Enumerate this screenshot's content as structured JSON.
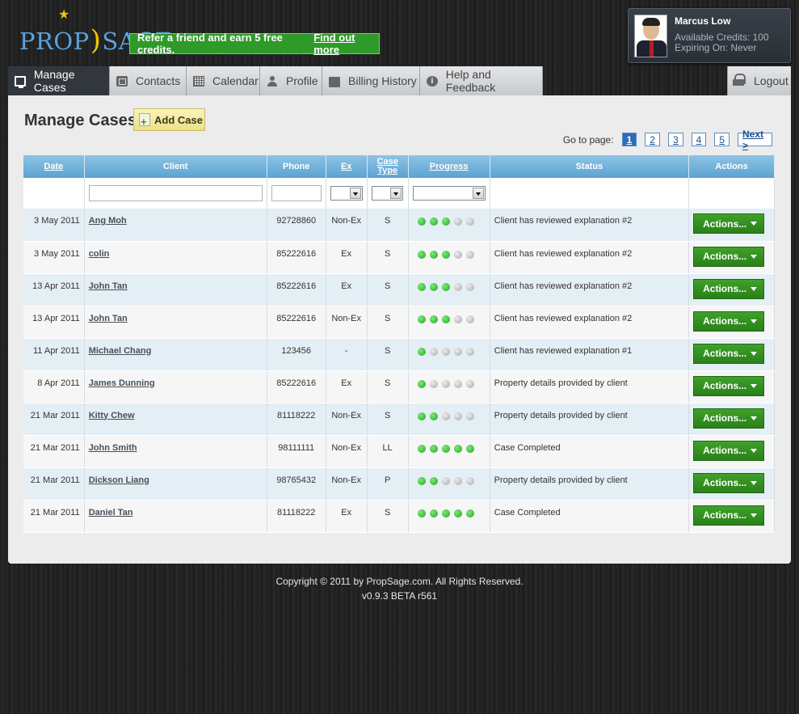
{
  "brand": {
    "name_left": "PROP",
    "name_right": "SAGE"
  },
  "promo": {
    "text": "Refer a friend and earn 5 free credits.",
    "link": "Find out more"
  },
  "user": {
    "name": "Marcus Low",
    "credits": "Available Credits: 100",
    "expiry": "Expiring On: Never"
  },
  "nav": {
    "tabs": [
      {
        "label": "Manage Cases",
        "icon": "monitor-icon"
      },
      {
        "label": "Contacts",
        "icon": "contacts-book-icon"
      },
      {
        "label": "Calendar",
        "icon": "calendar-icon"
      },
      {
        "label": "Profile",
        "icon": "user-icon"
      },
      {
        "label": "Billing History",
        "icon": "cash-icon"
      },
      {
        "label": "Help and Feedback",
        "icon": "help-icon"
      }
    ],
    "logout": "Logout"
  },
  "page": {
    "title": "Manage Cases",
    "add_case": "Add Case"
  },
  "pager": {
    "label": "Go to page:",
    "pages": [
      "1",
      "2",
      "3",
      "4",
      "5"
    ],
    "current": "1",
    "next": "Next >"
  },
  "table": {
    "headers": {
      "date": "Date",
      "client": "Client",
      "phone": "Phone",
      "ex": "Ex",
      "case_type_1": "Case",
      "case_type_2": "Type",
      "progress": "Progress",
      "status": "Status",
      "actions": "Actions"
    },
    "action_label": "Actions...",
    "rows": [
      {
        "date": "3 May 2011",
        "client": "Ang Moh",
        "phone": "92728860",
        "ex": "Non-Ex",
        "type": "S",
        "progress": 3,
        "status": "Client has reviewed explanation #2"
      },
      {
        "date": "3 May 2011",
        "client": "colin",
        "phone": "85222616",
        "ex": "Ex",
        "type": "S",
        "progress": 3,
        "status": "Client has reviewed explanation #2"
      },
      {
        "date": "13 Apr 2011",
        "client": "John Tan",
        "phone": "85222616",
        "ex": "Ex",
        "type": "S",
        "progress": 3,
        "status": "Client has reviewed explanation #2"
      },
      {
        "date": "13 Apr 2011",
        "client": "John Tan",
        "phone": "85222616",
        "ex": "Non-Ex",
        "type": "S",
        "progress": 3,
        "status": "Client has reviewed explanation #2"
      },
      {
        "date": "11 Apr 2011",
        "client": "Michael Chang",
        "phone": "123456",
        "ex": "-",
        "type": "S",
        "progress": 1,
        "status": "Client has reviewed explanation #1"
      },
      {
        "date": "8 Apr 2011",
        "client": "James Dunning",
        "phone": "85222616",
        "ex": "Ex",
        "type": "S",
        "progress": 1,
        "status": "Property details provided by client"
      },
      {
        "date": "21 Mar 2011",
        "client": "Kitty Chew",
        "phone": "81118222",
        "ex": "Non-Ex",
        "type": "S",
        "progress": 2,
        "status": "Property details provided by client"
      },
      {
        "date": "21 Mar 2011",
        "client": "John Smith",
        "phone": "98111111",
        "ex": "Non-Ex",
        "type": "LL",
        "progress": 5,
        "status": "Case Completed"
      },
      {
        "date": "21 Mar 2011",
        "client": "Dickson Liang",
        "phone": "98765432",
        "ex": "Non-Ex",
        "type": "P",
        "progress": 2,
        "status": "Property details provided by client"
      },
      {
        "date": "21 Mar 2011",
        "client": "Daniel Tan",
        "phone": "81118222",
        "ex": "Ex",
        "type": "S",
        "progress": 5,
        "status": "Case Completed"
      }
    ],
    "progress_max": 5
  },
  "footer": {
    "copyright": "Copyright © 2011 by PropSage.com. All Rights Reserved.",
    "version": "v0.9.3 BETA r561"
  }
}
